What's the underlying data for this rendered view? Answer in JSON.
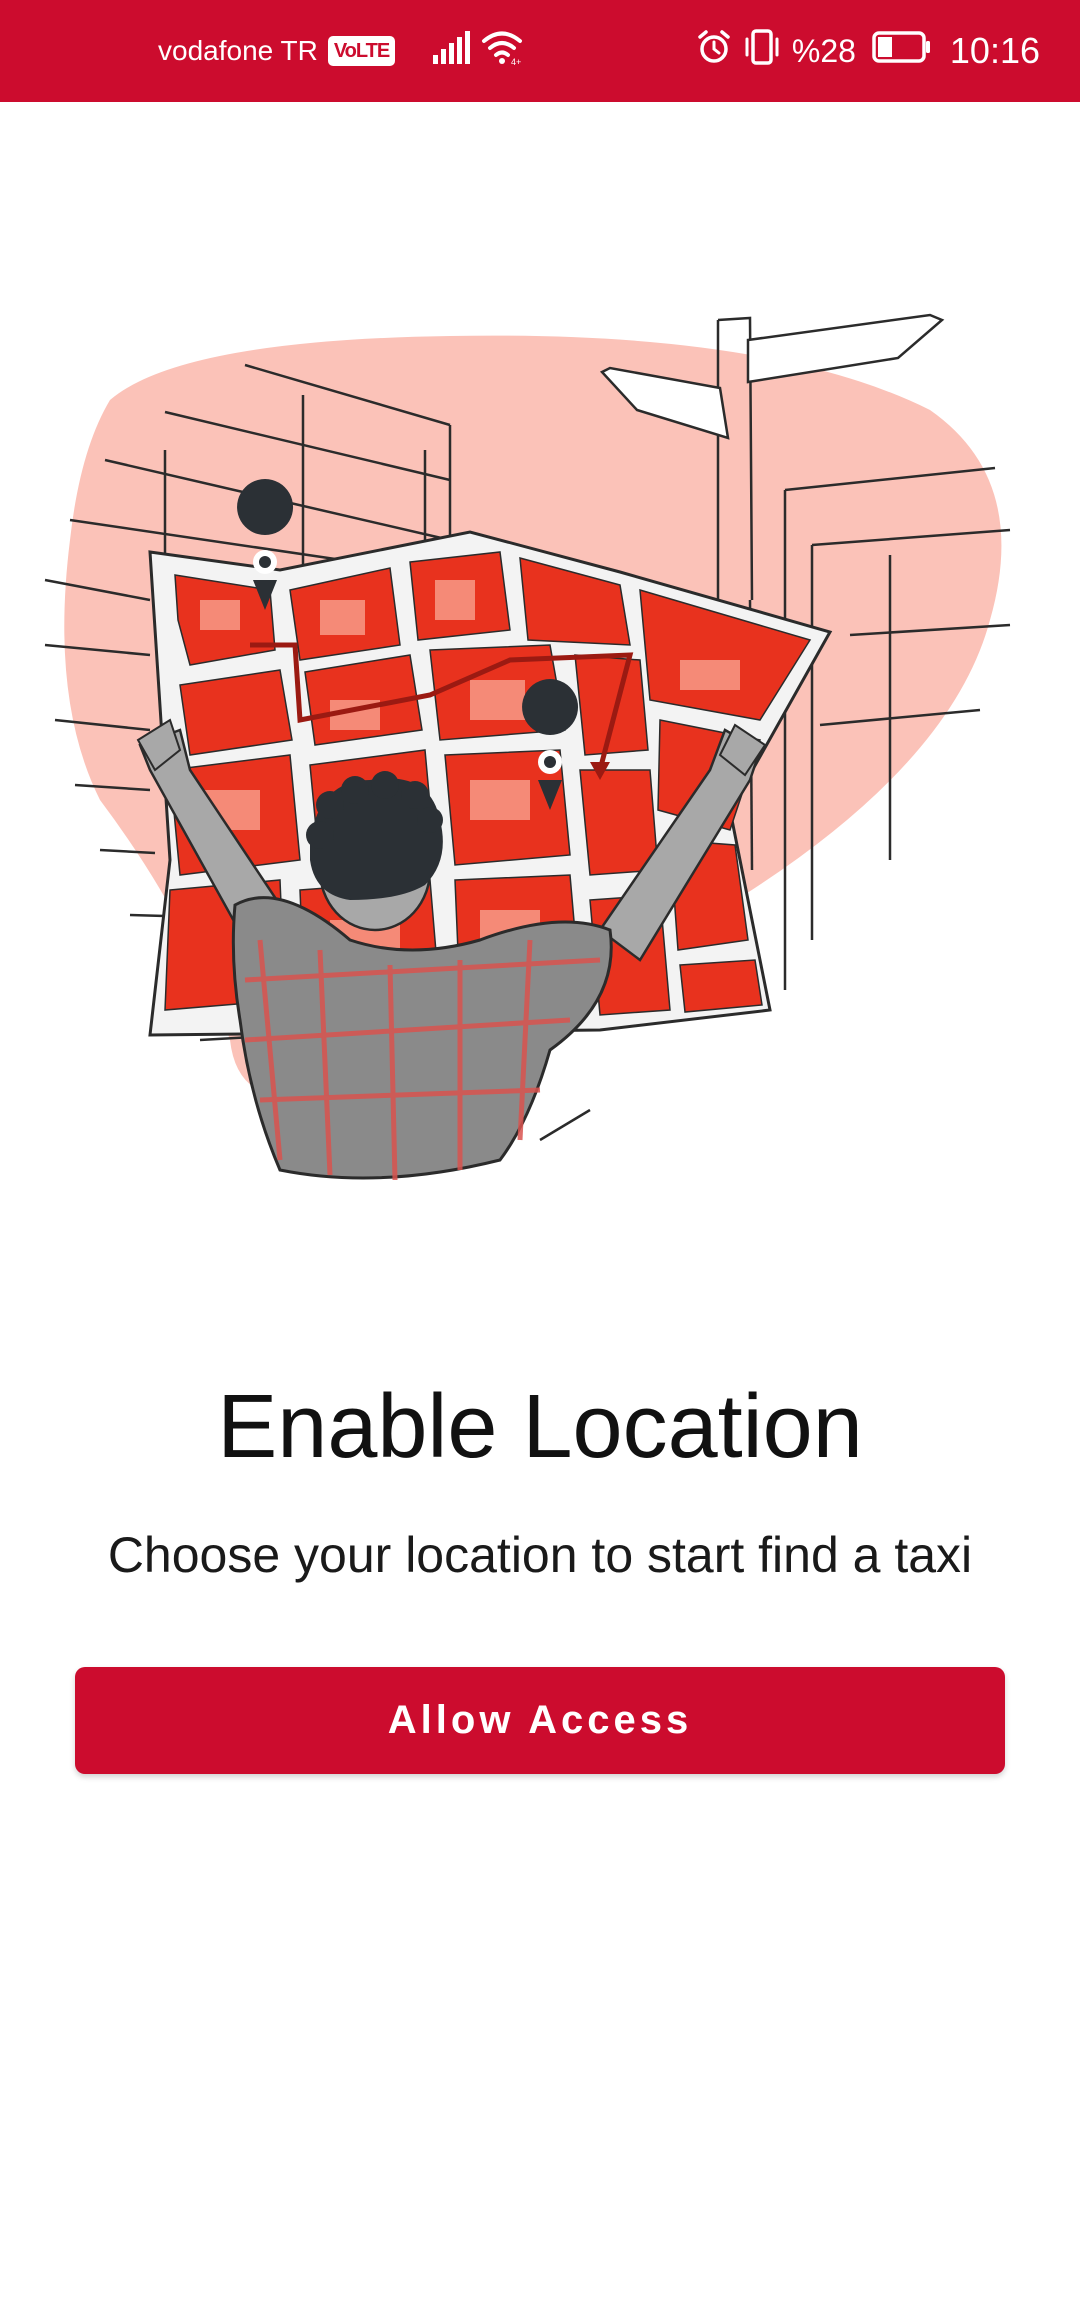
{
  "status_bar": {
    "carrier": "vodafone TR",
    "volte_badge": "VoLTE",
    "battery_percent": "%28",
    "time": "10:16",
    "icons": [
      "signal-icon",
      "wifi-icon",
      "alarm-icon",
      "vibrate-icon",
      "battery-icon"
    ],
    "background_color": "#cc0c2e"
  },
  "illustration": {
    "icon": "person-holding-map-illustration",
    "accent_color": "#e8321e",
    "blob_color": "#fbc2b8"
  },
  "main": {
    "title": "Enable Location",
    "subtitle": "Choose your location to start find a taxi",
    "allow_button_label": "Allow Access"
  },
  "colors": {
    "brand": "#cc0c2e"
  }
}
